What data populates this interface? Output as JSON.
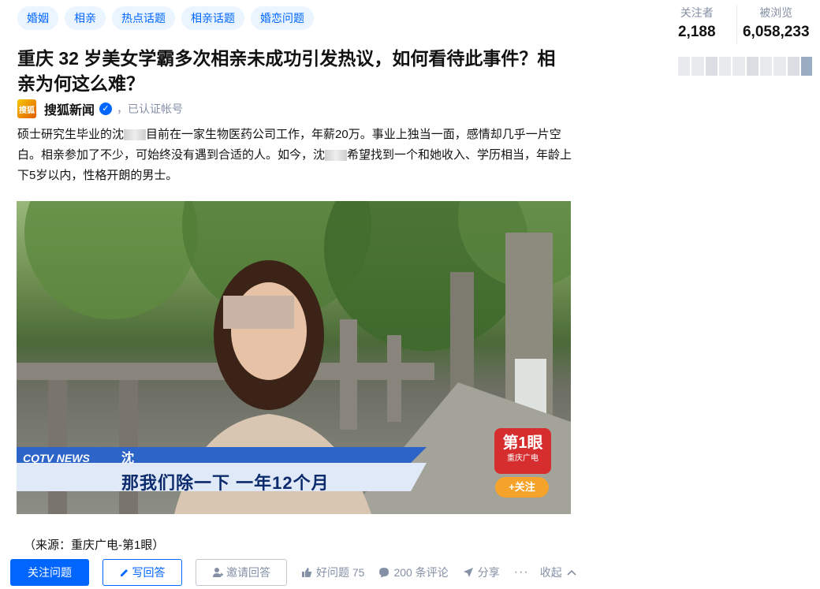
{
  "topics": [
    "婚姻",
    "相亲",
    "热点话题",
    "相亲话题",
    "婚恋问题"
  ],
  "stats": {
    "followers_label": "关注者",
    "followers_value": "2,188",
    "views_label": "被浏览",
    "views_value": "6,058,233"
  },
  "question": {
    "title": "重庆 32 岁美女学霸多次相亲未成功引发热议，如何看待此事件？相亲为何这么难？"
  },
  "author": {
    "avatar_text": "搜狐",
    "name": "搜狐新闻",
    "verified_text": "，已认证帐号"
  },
  "excerpt": {
    "part1": "硕士研究生毕业的沈",
    "part2": "目前在一家生物医药公司工作，年薪20万。事业上独当一面，感情却几乎一片空白。相亲参加了不少，可始终没有遇到合适的人。如今，沈",
    "part3": "希望找到一个和她收入、学历相当，年龄上下5岁以内，性格开朗的男士。"
  },
  "video": {
    "caption_name": "沈",
    "caption_text": "那我们除一下  一年12个月",
    "logo_left": "CQTV NEWS",
    "channel_big": "第1眼",
    "channel_small": "重庆广电",
    "follow_badge": "+关注"
  },
  "source": "（来源：重庆广电-第1眼）",
  "actions": {
    "follow_question": "关注问题",
    "write_answer": "写回答",
    "invite_answer": "邀请回答",
    "good_question": "好问题 75",
    "comments": "200 条评论",
    "share": "分享",
    "more": "···",
    "collapse": "收起"
  },
  "colors": {
    "accent": "#0066ff",
    "muted": "#8590a6",
    "topic_bg": "#ebf5ff"
  }
}
